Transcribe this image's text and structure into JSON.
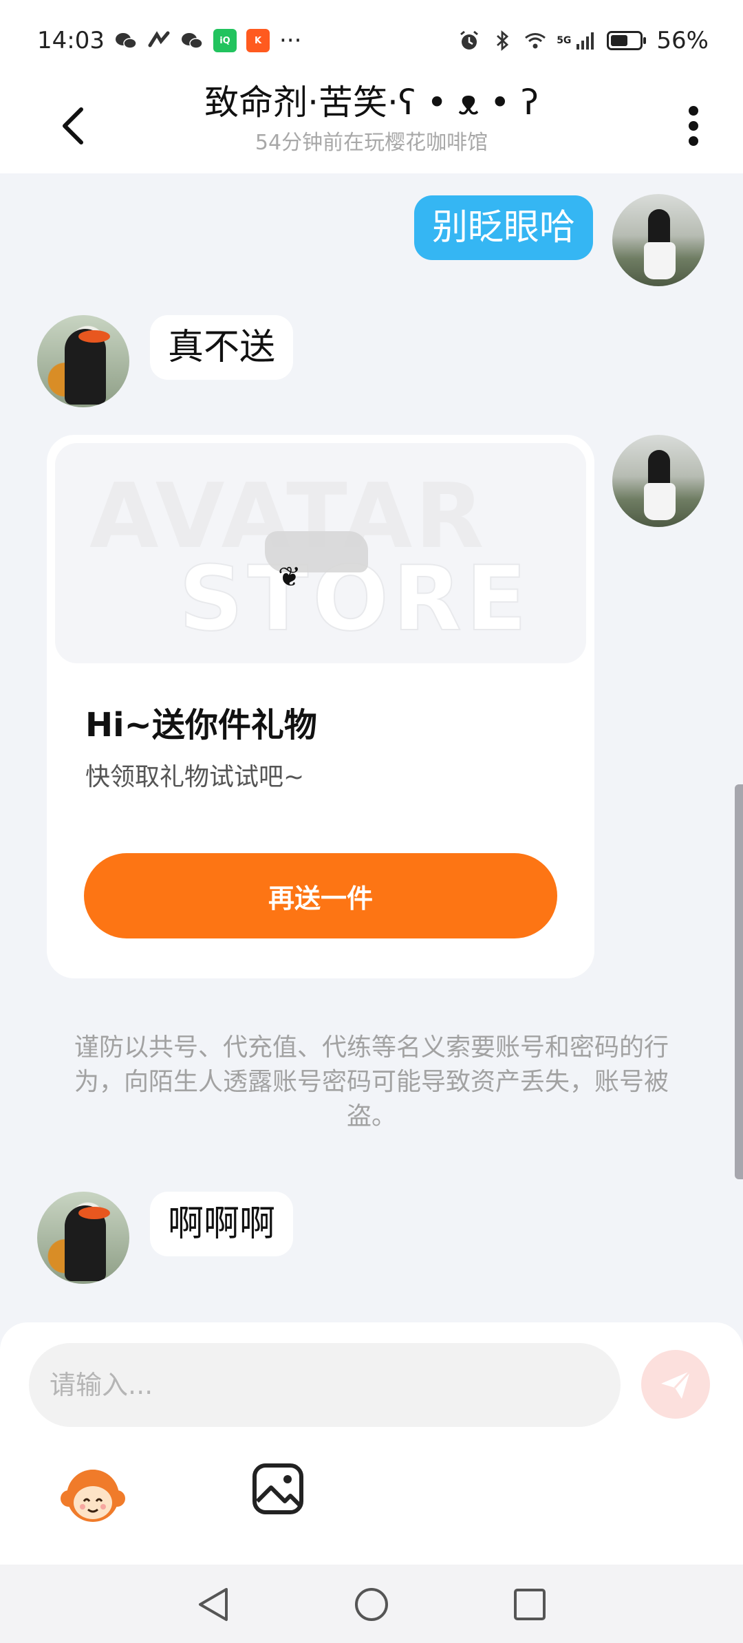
{
  "status_bar": {
    "time": "14:03",
    "more": "···",
    "network": "5G",
    "battery": "56%",
    "icons": [
      "wechat-icon",
      "signal-app-icon",
      "wechat-icon",
      "iqiyi-icon",
      "kuaishou-icon",
      "alarm-icon",
      "bluetooth-icon",
      "wifi-icon",
      "cellular-icon",
      "battery-icon"
    ]
  },
  "header": {
    "title": "致命剂·苦笑·ʕ • ᴥ • ʔ",
    "subtitle": "54分钟前在玩樱花咖啡馆"
  },
  "messages": [
    {
      "from": "me",
      "text": "别眨眼哈"
    },
    {
      "from": "other",
      "text": "真不送"
    },
    {
      "from": "me",
      "type": "gift-card"
    },
    {
      "from": "other",
      "text": "啊啊啊"
    }
  ],
  "gift_card": {
    "watermark_line1": "AVATAR",
    "watermark_line2": "STORE",
    "title": "Hi~送你件礼物",
    "description": "快领取礼物试试吧~",
    "button_label": "再送一件"
  },
  "notice": "谨防以共号、代充值、代练等名义索要账号和密码的行为，向陌生人透露账号密码可能导致资产丢失，账号被盗。",
  "input": {
    "placeholder": "请输入..."
  },
  "colors": {
    "accent_blue": "#35b6f3",
    "accent_orange": "#fd7514",
    "background": "#f2f4f8"
  }
}
